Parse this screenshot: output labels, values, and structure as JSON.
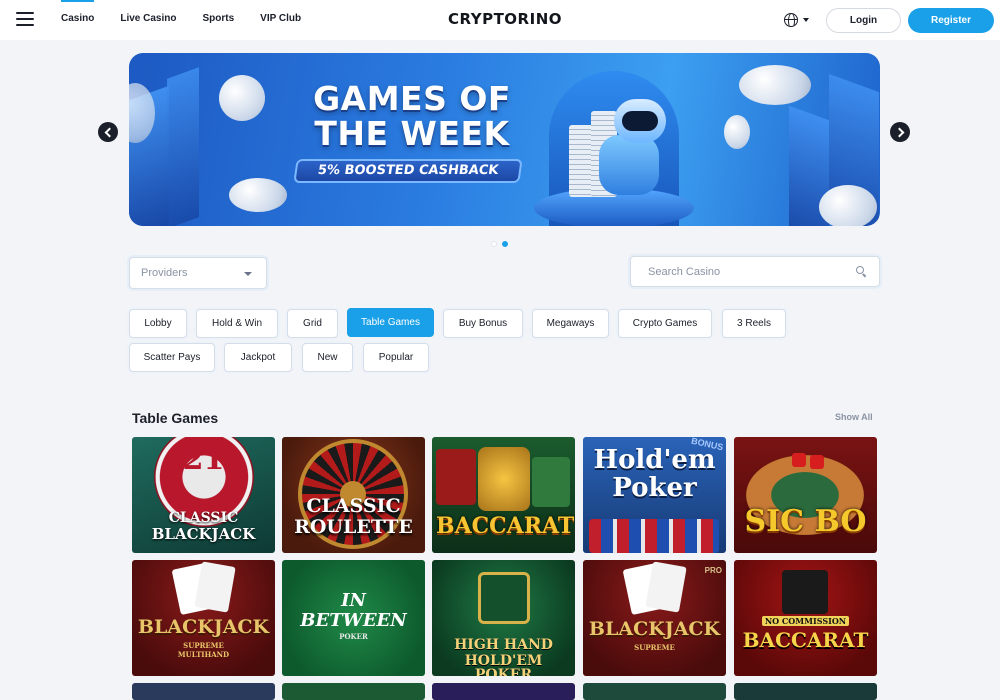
{
  "header": {
    "nav": [
      "Casino",
      "Live Casino",
      "Sports",
      "VIP Club"
    ],
    "logo": "CRYPTORINO",
    "login_label": "Login",
    "register_label": "Register"
  },
  "banner": {
    "title_line1": "GAMES OF",
    "title_line2": "THE WEEK",
    "subtitle": "5% BOOSTED CASHBACK",
    "slide_count": 1,
    "active_slide": 1
  },
  "filters": {
    "providers_placeholder": "Providers",
    "search_placeholder": "Search Casino",
    "chips": [
      "Lobby",
      "Hold & Win",
      "Grid",
      "Table Games",
      "Buy Bonus",
      "Megaways",
      "Crypto Games",
      "3 Reels",
      "Scatter Pays",
      "Jackpot",
      "New",
      "Popular"
    ],
    "active_chip": "Table Games"
  },
  "section": {
    "title": "Table Games",
    "show_all": "Show All"
  },
  "games": [
    {
      "line1": "21",
      "line2": "CLASSIC",
      "line3": "BLACKJACK"
    },
    {
      "line1": "CLASSIC",
      "line2": "ROULETTE"
    },
    {
      "line1": "BACCARAT"
    },
    {
      "line1": "Hold'em",
      "line2": "Poker",
      "tag": "BONUS"
    },
    {
      "line1": "SIC BO"
    },
    {
      "line1": "BLACKJACK",
      "line2": "SUPREME",
      "line3": "MULTIHAND"
    },
    {
      "line1": "IN",
      "line2": "BETWEEN",
      "line3": "POKER"
    },
    {
      "line1": "HIGH HAND",
      "line2": "HOLD'EM POKER"
    },
    {
      "line1": "BLACKJACK",
      "line2": "SUPREME",
      "tag": "PRO"
    },
    {
      "line1": "NO COMMISSION",
      "line2": "BACCARAT"
    }
  ],
  "colors": {
    "accent": "#19a0e8",
    "background": "#f3f4f7",
    "text": "#1b1f2a",
    "muted": "#8a93a3"
  },
  "icons": [
    "hamburger-menu-icon",
    "globe-icon",
    "chevron-down-icon",
    "search-icon",
    "arrow-left-icon",
    "arrow-right-icon"
  ]
}
